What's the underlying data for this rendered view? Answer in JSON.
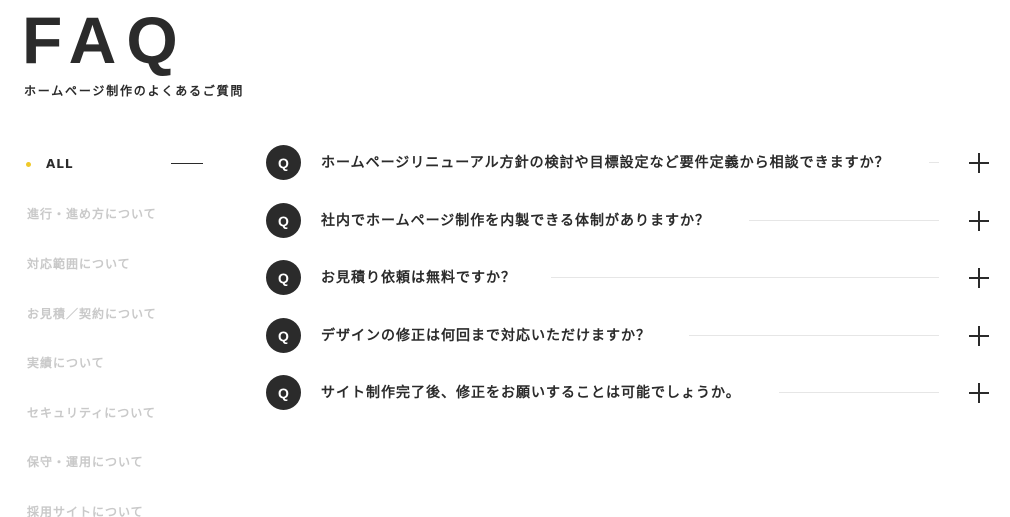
{
  "hero": {
    "title": "FAQ",
    "subtitle": "ホームページ制作のよくあるご質問"
  },
  "categories": [
    {
      "label": "ALL",
      "active": true
    },
    {
      "label": "進行・進め方について",
      "active": false
    },
    {
      "label": "対応範囲について",
      "active": false
    },
    {
      "label": "お見積／契約について",
      "active": false
    },
    {
      "label": "実績について",
      "active": false
    },
    {
      "label": "セキュリティについて",
      "active": false
    },
    {
      "label": "保守・運用について",
      "active": false
    },
    {
      "label": "採用サイトについて",
      "active": false
    }
  ],
  "faq": {
    "badge": "Q",
    "items": [
      {
        "question": "ホームページリニューアル方針の検討や目標設定など要件定義から相談できますか？"
      },
      {
        "question": "社内でホームページ制作を内製できる体制がありますか？"
      },
      {
        "question": "お見積り依頼は無料ですか？"
      },
      {
        "question": "デザインの修正は何回まで対応いただけますか？"
      },
      {
        "question": "サイト制作完了後、修正をお願いすることは可能でしょうか。"
      }
    ]
  },
  "colors": {
    "text": "#2b2b2b",
    "muted": "#c9c9c9",
    "accent_dot": "#f0c929",
    "rule": "#e6e6e6"
  },
  "icons": {
    "expand": "plus-icon",
    "active_marker": "dot-icon"
  }
}
